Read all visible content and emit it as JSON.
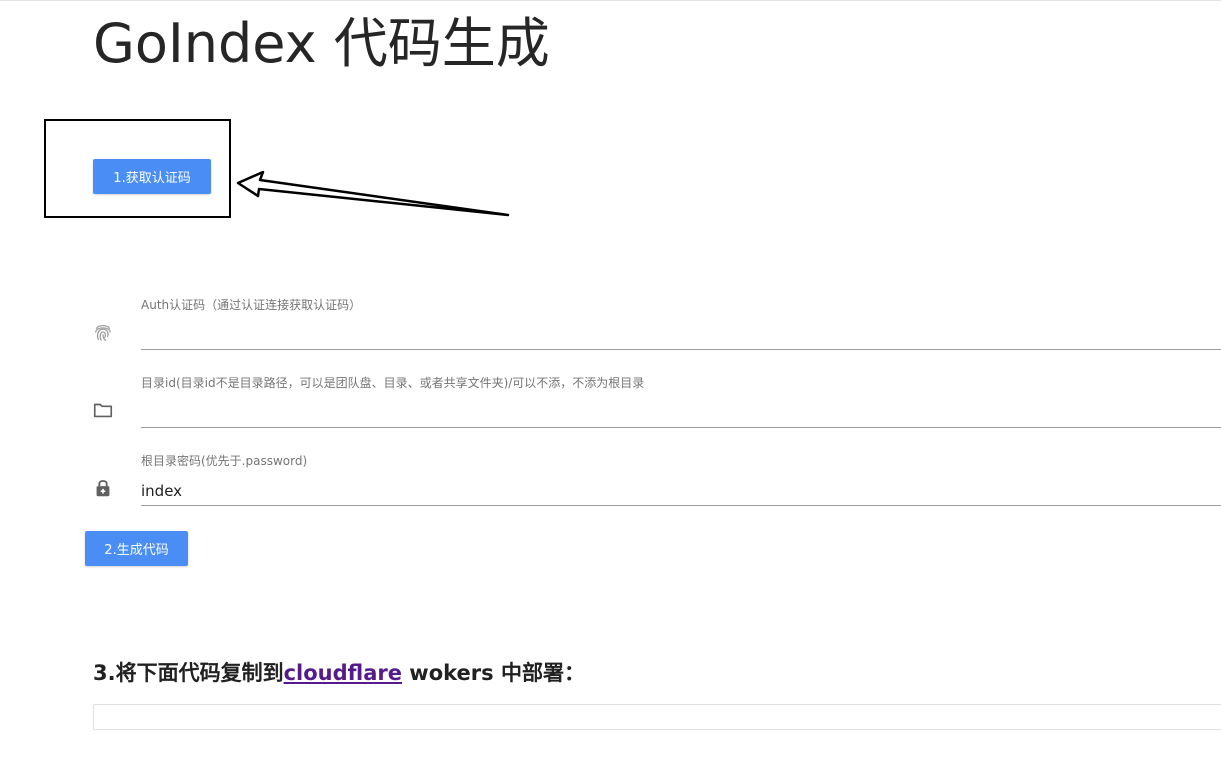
{
  "page": {
    "title": "GoIndex 代码生成"
  },
  "step1": {
    "button_label": "1.获取认证码"
  },
  "form": {
    "auth": {
      "label": "Auth认证码（通过认证连接获取认证码）",
      "value": "",
      "icon": "fingerprint-icon"
    },
    "folder_id": {
      "label": "目录id(目录id不是目录路径，可以是团队盘、目录、或者共享文件夹)/可以不添，不添为根目录",
      "value": "",
      "icon": "folder-icon"
    },
    "root_password": {
      "label": "根目录密码(优先于.password)",
      "value": "index",
      "icon": "lock-icon"
    }
  },
  "step2": {
    "button_label": "2.生成代码"
  },
  "step3": {
    "heading_prefix": "3.将下面代码复制到",
    "link_text": "cloudflare",
    "heading_suffix": " wokers 中部署："
  },
  "code_output": {
    "value": ""
  },
  "colors": {
    "button": "#4a8ef5",
    "link_visited": "#551a8b",
    "annotation": "#000000"
  }
}
